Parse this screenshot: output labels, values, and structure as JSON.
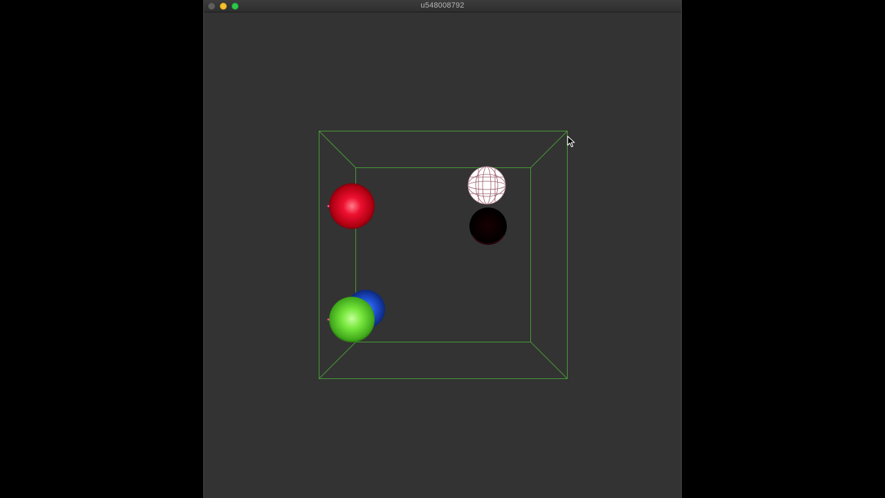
{
  "window": {
    "title": "u548008792"
  },
  "scene": {
    "box_color": "#4caf37",
    "background": "#333333",
    "spheres": [
      {
        "name": "red-sphere",
        "color": "#e0001b",
        "style": "shaded"
      },
      {
        "name": "blue-sphere",
        "color": "#1e4fd6",
        "style": "shaded"
      },
      {
        "name": "green-sphere",
        "color": "#6ee23a",
        "style": "shaded"
      },
      {
        "name": "white-wireframe-sphere",
        "color": "#ffffff",
        "style": "wireframe"
      },
      {
        "name": "black-sphere",
        "color": "#000000",
        "style": "shaded"
      }
    ]
  },
  "icons": {
    "cursor": "arrow-pointer-icon"
  }
}
